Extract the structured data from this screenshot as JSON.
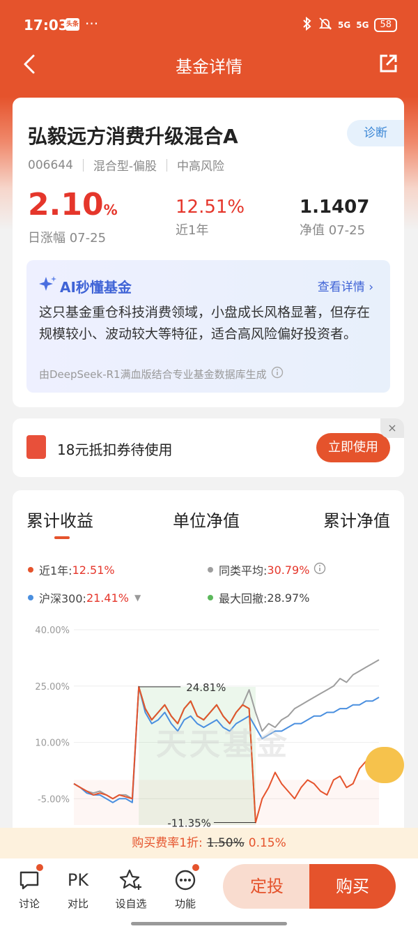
{
  "status": {
    "time": "17:03",
    "badge": "头条",
    "dots": "···",
    "battery": "58",
    "sig1": "5G",
    "sig2": "5G"
  },
  "nav": {
    "title": "基金详情"
  },
  "fund": {
    "name": "弘毅远方消费升级混合A",
    "diagnose": "诊断",
    "code": "006644",
    "type": "混合型-偏股",
    "risk": "中高风险",
    "daily_change": "2.10",
    "daily_change_unit": "%",
    "daily_label": "日涨幅 07-25",
    "year_return": "12.51%",
    "year_label": "近1年",
    "nav_value": "1.1407",
    "nav_label": "净值 07-25"
  },
  "ai": {
    "title": "AI秒懂基金",
    "link": "查看详情",
    "text": "这只基金重仓科技消费领域，小盘成长风格显著，但存在规模较小、波动较大等特征，适合高风险偏好投资者。",
    "footer": "由DeepSeek-R1满血版结合专业基金数据库生成"
  },
  "coupon": {
    "text": "18元抵扣券待使用",
    "button": "立即使用",
    "close": "×"
  },
  "chart_tabs": [
    "累计收益",
    "单位净值",
    "累计净值"
  ],
  "legend": {
    "near1y_label": "近1年:",
    "near1y_value": "12.51%",
    "peer_label": "同类平均:",
    "peer_value": "30.79%",
    "hs300_label": "沪深300:",
    "hs300_value": "21.41%",
    "drawdown_label": "最大回撤:",
    "drawdown_value": "28.97%"
  },
  "watermark": "天天基金",
  "colors": {
    "fund": "#e5532c",
    "peer": "#9e9e9e",
    "hs300": "#4a8fdf",
    "drawdown": "#5cb85c"
  },
  "chart_data": {
    "type": "line",
    "y_ticks": [
      "40.00%",
      "25.00%",
      "10.00%",
      "-5.00%"
    ],
    "ylim": [
      -12,
      40
    ],
    "annotations": [
      "24.81%",
      "-11.35%"
    ],
    "series": [
      {
        "name": "近1年",
        "values": [
          -1,
          -2,
          -3,
          -4,
          -3.5,
          -4,
          -5,
          -4,
          -4.5,
          -5,
          24.8,
          19,
          16,
          18,
          20,
          17,
          15,
          19,
          21,
          17,
          16,
          18,
          20,
          17,
          15,
          18,
          20,
          19,
          -11.35,
          -5,
          -2,
          2,
          -1,
          -3,
          -5,
          -2,
          0,
          -1,
          -3,
          -4,
          0,
          1,
          -2,
          -1,
          3,
          5,
          6,
          8
        ]
      },
      {
        "name": "同类平均",
        "values": [
          -1,
          -2,
          -3,
          -3.5,
          -3,
          -4,
          -5,
          -4,
          -4,
          -5,
          24.8,
          19,
          16,
          18,
          20,
          17,
          15,
          19,
          21,
          17,
          16,
          18,
          20,
          17,
          15,
          18,
          20,
          24,
          18,
          13,
          15,
          14,
          16,
          17,
          19,
          20,
          21,
          22,
          23,
          24,
          25,
          27,
          26,
          28,
          29,
          30,
          31,
          32
        ]
      },
      {
        "name": "沪深300",
        "values": [
          -1,
          -2,
          -3.5,
          -4,
          -4,
          -5,
          -6,
          -5,
          -5,
          -6,
          24.8,
          18,
          15,
          16,
          18,
          15,
          13,
          16,
          17,
          15,
          14,
          15,
          16,
          14,
          13,
          15,
          16,
          17,
          14,
          11,
          12,
          13,
          13,
          14,
          15,
          15,
          16,
          17,
          17,
          18,
          18,
          19,
          19,
          20,
          20,
          21,
          21,
          22
        ]
      },
      {
        "name": "最大回撤",
        "values": [
          null,
          null,
          null,
          null,
          null,
          null,
          null,
          null,
          null,
          null,
          24.8,
          19,
          16,
          18,
          20,
          17,
          15,
          19,
          21,
          17,
          16,
          18,
          20,
          17,
          15,
          18,
          20,
          19,
          -11.35
        ]
      }
    ]
  },
  "fee": {
    "prefix": "购买费率1折:",
    "old": "1.50%",
    "new": "0.15%"
  },
  "bottom": {
    "items": [
      "讨论",
      "对比",
      "设自选",
      "功能"
    ],
    "pk": "PK",
    "dingtou": "定投",
    "buy": "购买"
  }
}
